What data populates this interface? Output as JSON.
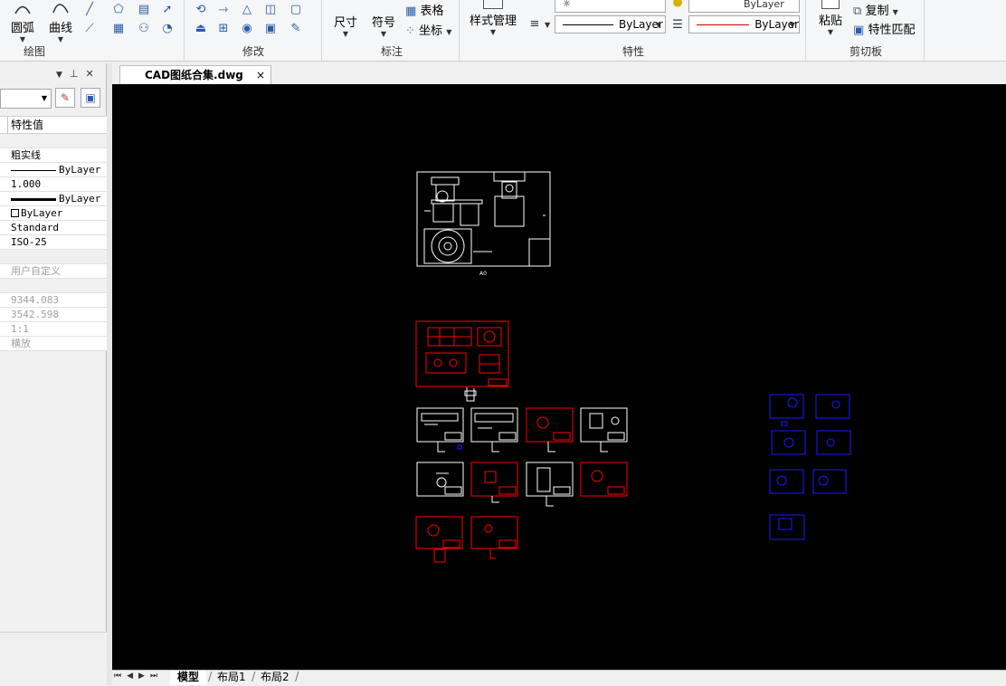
{
  "ribbon": {
    "groups": {
      "draw": "绘图",
      "modify": "修改",
      "annotate": "标注",
      "properties": "特性",
      "clipboard": "剪切板"
    },
    "draw_buttons": {
      "arc": "圆弧",
      "curve": "曲线"
    },
    "annotate_buttons": {
      "dimension": "尺寸",
      "symbol": "符号",
      "table": "表格",
      "coordinate": "坐标"
    },
    "style_manager": "样式管理",
    "property_combos": {
      "linetype": "ByLayer",
      "color": "ByLayer",
      "lineweight_top": "ByLayer"
    },
    "clipboard_buttons": {
      "paste": "粘贴",
      "copy": "复制",
      "match_properties": "特性匹配"
    }
  },
  "palette": {
    "column_header": "特性值",
    "rows": [
      {
        "text": "",
        "kind": "blank"
      },
      {
        "text": "粗实线",
        "kind": "cn"
      },
      {
        "text": "ByLayer",
        "kind": "line"
      },
      {
        "text": "1.000",
        "kind": "mono"
      },
      {
        "text": "ByLayer",
        "kind": "thickline"
      },
      {
        "text": "ByLayer",
        "kind": "check"
      },
      {
        "text": "Standard",
        "kind": "mono"
      },
      {
        "text": "ISO-25",
        "kind": "mono"
      },
      {
        "text": "",
        "kind": "blank"
      },
      {
        "text": "用户自定义",
        "kind": "cn-dim"
      },
      {
        "text": "",
        "kind": "blank"
      },
      {
        "text": "9344.083",
        "kind": "mono-dim"
      },
      {
        "text": "3542.598",
        "kind": "mono-dim"
      },
      {
        "text": "1:1",
        "kind": "mono-dim"
      },
      {
        "text": "横放",
        "kind": "cn-dim"
      }
    ]
  },
  "document_tab": {
    "title": "CAD图纸合集.dwg",
    "close": "×"
  },
  "canvas": {
    "main_sheet_label": "A0"
  },
  "layout_tabs": {
    "model": "模型",
    "layout1": "布局1",
    "layout2": "布局2"
  },
  "colors": {
    "canvas_bg": "#000000",
    "white_sheet": "#ffffff",
    "red_sheet": "#ff0000",
    "blue_sheet": "#1a1aff"
  }
}
